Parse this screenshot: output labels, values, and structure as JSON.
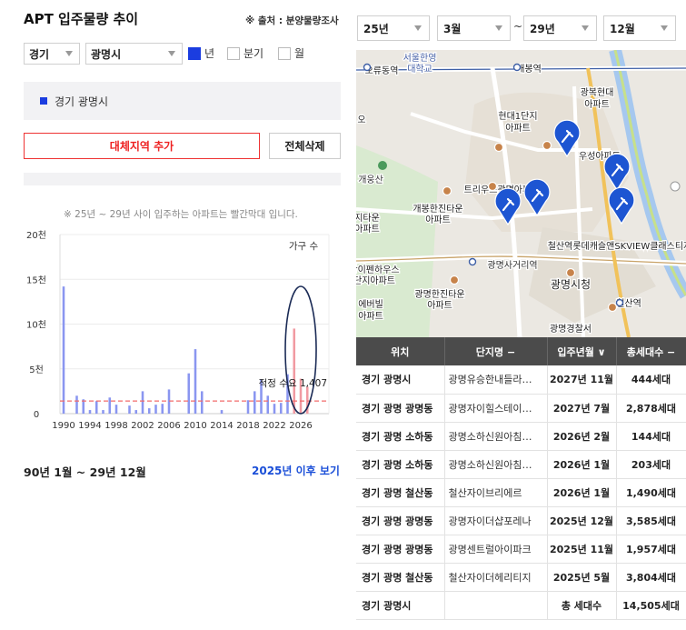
{
  "header": {
    "title": "APT 입주물량 추이",
    "source": "※ 출처 : 분양물량조사"
  },
  "filters": {
    "province": "경기",
    "city": "광명시",
    "period_options": [
      {
        "label": "년",
        "checked": true
      },
      {
        "label": "분기",
        "checked": false
      },
      {
        "label": "월",
        "checked": false
      }
    ]
  },
  "region_list": {
    "items": [
      "경기 광명시"
    ]
  },
  "buttons": {
    "add_region": "대체지역 추가",
    "delete_all": "전체삭제",
    "after_2025": "2025년 이후 보기"
  },
  "note": "※ 25년 ~ 29년 사이 입주하는 아파트는 빨간막대 입니다.",
  "range_label": "90년 1월 ~ 29년 12월",
  "chart_data": {
    "type": "bar",
    "ylabel": "가구 수",
    "y_ticks": [
      "0",
      "5천",
      "10천",
      "15천",
      "20천"
    ],
    "ylim": [
      0,
      20000
    ],
    "x_tick_labels": [
      "1990",
      "1994",
      "1998",
      "2002",
      "2006",
      "2010",
      "2014",
      "2018",
      "2022",
      "2026"
    ],
    "x": [
      1990,
      1991,
      1992,
      1993,
      1994,
      1995,
      1996,
      1997,
      1998,
      1999,
      2000,
      2001,
      2002,
      2003,
      2004,
      2005,
      2006,
      2007,
      2008,
      2009,
      2010,
      2011,
      2012,
      2013,
      2014,
      2015,
      2016,
      2017,
      2018,
      2019,
      2020,
      2021,
      2022,
      2023,
      2024,
      2025,
      2026,
      2027,
      2028,
      2029
    ],
    "values": [
      14200,
      0,
      2000,
      1600,
      400,
      1400,
      400,
      1800,
      1000,
      0,
      900,
      400,
      2500,
      600,
      1000,
      1100,
      2700,
      0,
      0,
      4500,
      7200,
      2500,
      0,
      0,
      400,
      0,
      0,
      0,
      1500,
      2500,
      3800,
      2000,
      1100,
      1200,
      4400,
      9500,
      3900,
      3000,
      0,
      0
    ],
    "highlight_from": 2025,
    "colors": {
      "normal": "#8a96f0",
      "highlight": "#f19aa2",
      "avg_line": "#f26b6b"
    },
    "reference_line": {
      "label": "적정 수요 1,407",
      "value": 1407
    },
    "grid": "horizontal"
  },
  "date_filter": {
    "start_year": "25년",
    "start_month": "3월",
    "end_year": "29년",
    "end_month": "12월",
    "separator": "~"
  },
  "map": {
    "labels": [
      {
        "text": "서울한영"
      },
      {
        "text": "대학교"
      },
      {
        "text": "오류동역"
      },
      {
        "text": "개봉역"
      },
      {
        "text": "광복현대"
      },
      {
        "text": "아파트"
      },
      {
        "text": "현대1단지"
      },
      {
        "text": "아파트"
      },
      {
        "text": "우성아파트"
      },
      {
        "text": "개웅산"
      },
      {
        "text": "트리우스광명아파트"
      },
      {
        "text": "개봉한진타운"
      },
      {
        "text": "아파트"
      },
      {
        "text": "지타운"
      },
      {
        "text": "아파트"
      },
      {
        "text": "철산역롯데캐슬앤SKVIEW클래스티지"
      },
      {
        "text": "광명사거리역"
      },
      {
        "text": "왕이펜하우스"
      },
      {
        "text": "단지아파트"
      },
      {
        "text": "광명시청"
      },
      {
        "text": "광명한진타운"
      },
      {
        "text": "아파트"
      },
      {
        "text": "에버빌"
      },
      {
        "text": "아파트"
      },
      {
        "text": "철산역"
      },
      {
        "text": "광명경찰서"
      },
      {
        "text": "오"
      }
    ]
  },
  "table": {
    "headers": [
      "위치",
      "단지명 −",
      "입주년월 ∨",
      "총세대수 −"
    ],
    "rows": [
      {
        "loc": "경기 광명시",
        "name": "광명유승한내들라…",
        "date": "2027년 11월",
        "units": "444세대"
      },
      {
        "loc": "경기 광명 광명동",
        "name": "광명자이힐스테이…",
        "date": "2027년 7월",
        "units": "2,878세대"
      },
      {
        "loc": "경기 광명 소하동",
        "name": "광명소하신원아침…",
        "date": "2026년 2월",
        "units": "144세대"
      },
      {
        "loc": "경기 광명 소하동",
        "name": "광명소하신원아침…",
        "date": "2026년 1월",
        "units": "203세대"
      },
      {
        "loc": "경기 광명 철산동",
        "name": "철산자이브리에르",
        "date": "2026년 1월",
        "units": "1,490세대"
      },
      {
        "loc": "경기 광명 광명동",
        "name": "광명자이더샵포레나",
        "date": "2025년 12월",
        "units": "3,585세대"
      },
      {
        "loc": "경기 광명 광명동",
        "name": "광명센트럴아이파크",
        "date": "2025년 11월",
        "units": "1,957세대"
      },
      {
        "loc": "경기 광명 철산동",
        "name": "철산자이더헤리티지",
        "date": "2025년 5월",
        "units": "3,804세대"
      }
    ],
    "total": {
      "loc": "경기 광명시",
      "label": "총 세대수",
      "units": "14,505세대"
    }
  }
}
